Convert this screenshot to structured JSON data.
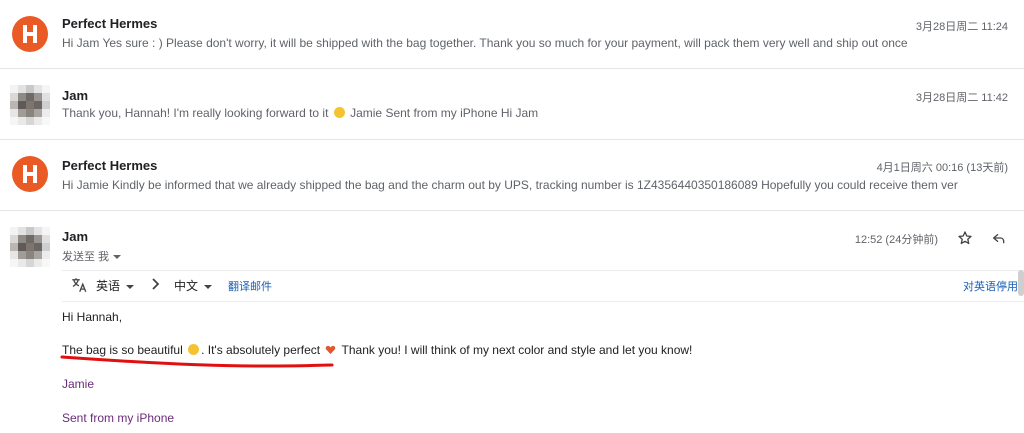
{
  "messages": [
    {
      "sender": "Perfect Hermes",
      "snippet": "Hi Jam Yes sure : ) Please don't worry, it will be shipped with the bag together. Thank you so much for your payment, will pack them very well and ship out once",
      "date": "3月28日周二 11:24"
    },
    {
      "sender": "Jam",
      "snippet_before": "Thank you, Hannah! I'm really looking forward to it ",
      "snippet_after": " Jamie Sent from my iPhone Hi Jam",
      "date": "3月28日周二 11:42"
    },
    {
      "sender": "Perfect Hermes",
      "snippet": "Hi Jamie Kindly be informed that we already shipped the bag and the charm out by UPS, tracking number is 1Z4356440350186089 Hopefully you could receive them ver",
      "date": "4月1日周六 00:16 (13天前)"
    }
  ],
  "open_message": {
    "sender": "Jam",
    "to_line": "发送至 我",
    "date": "12:52 (24分钟前)",
    "translate_bar": {
      "source_lang": "英语",
      "target_lang": "中文",
      "translate_link": "翻译邮件",
      "disable_link": "对英语停用"
    },
    "greeting": "Hi Hannah,",
    "line1_part1": "The bag is so beautiful ",
    "line1_part2": ". It's absolutely perfect ",
    "line1_part3": " Thank you! I will think of my next color and style and let you know!",
    "signature_name": "Jamie",
    "signature_sent": "Sent from my iPhone"
  },
  "colors": {
    "avatar_orange": "#ea5a24",
    "link_blue": "#1a5fb4",
    "signature_purple": "#6a2c7a",
    "annotation_red": "#e01010"
  },
  "icons": [
    "star-icon",
    "reply-icon",
    "translate-icon",
    "chevron-right-icon",
    "caret-down-icon"
  ]
}
